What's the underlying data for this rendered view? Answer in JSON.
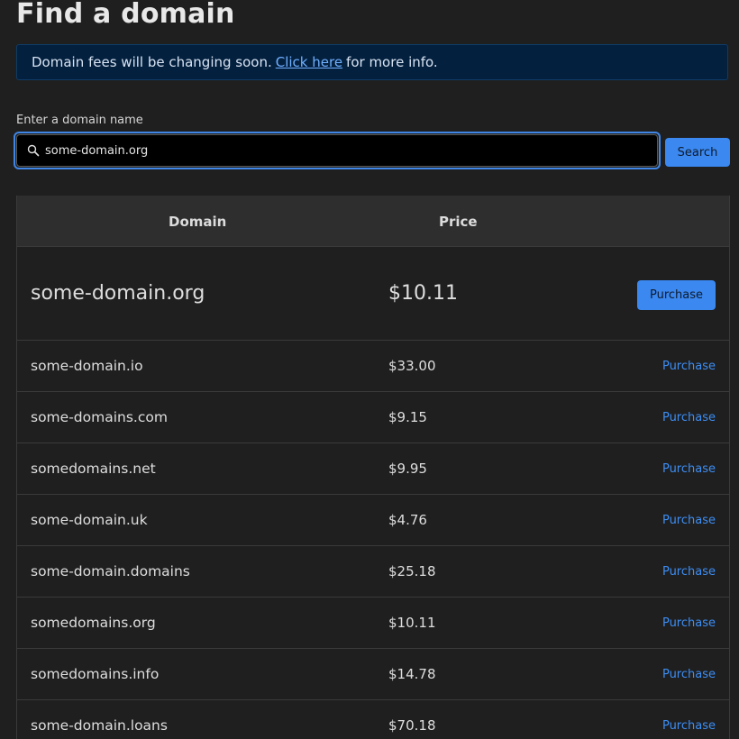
{
  "page_title": "Find a domain",
  "banner": {
    "text_before": "Domain fees will be changing soon.",
    "link_label": "Click here",
    "text_after": "for more info."
  },
  "search": {
    "label": "Enter a domain name",
    "value": "some-domain.org",
    "icon": "search-icon",
    "button_label": "Search"
  },
  "table": {
    "headers": [
      "Domain",
      "Price",
      ""
    ],
    "featured": {
      "domain": "some-domain.org",
      "price": "$10.11",
      "action": "Purchase"
    },
    "rows": [
      {
        "domain": "some-domain.io",
        "price": "$33.00",
        "action": "Purchase"
      },
      {
        "domain": "some-domains.com",
        "price": "$9.15",
        "action": "Purchase"
      },
      {
        "domain": "somedomains.net",
        "price": "$9.95",
        "action": "Purchase"
      },
      {
        "domain": "some-domain.uk",
        "price": "$4.76",
        "action": "Purchase"
      },
      {
        "domain": "some-domain.domains",
        "price": "$25.18",
        "action": "Purchase"
      },
      {
        "domain": "somedomains.org",
        "price": "$10.11",
        "action": "Purchase"
      },
      {
        "domain": "somedomains.info",
        "price": "$14.78",
        "action": "Purchase"
      },
      {
        "domain": "some-domain.loans",
        "price": "$70.18",
        "action": "Purchase"
      }
    ]
  },
  "colors": {
    "background": "#1f1f1f",
    "accent": "#3a88f0",
    "link": "#6fb0ff",
    "banner_bg": "#04203f"
  }
}
